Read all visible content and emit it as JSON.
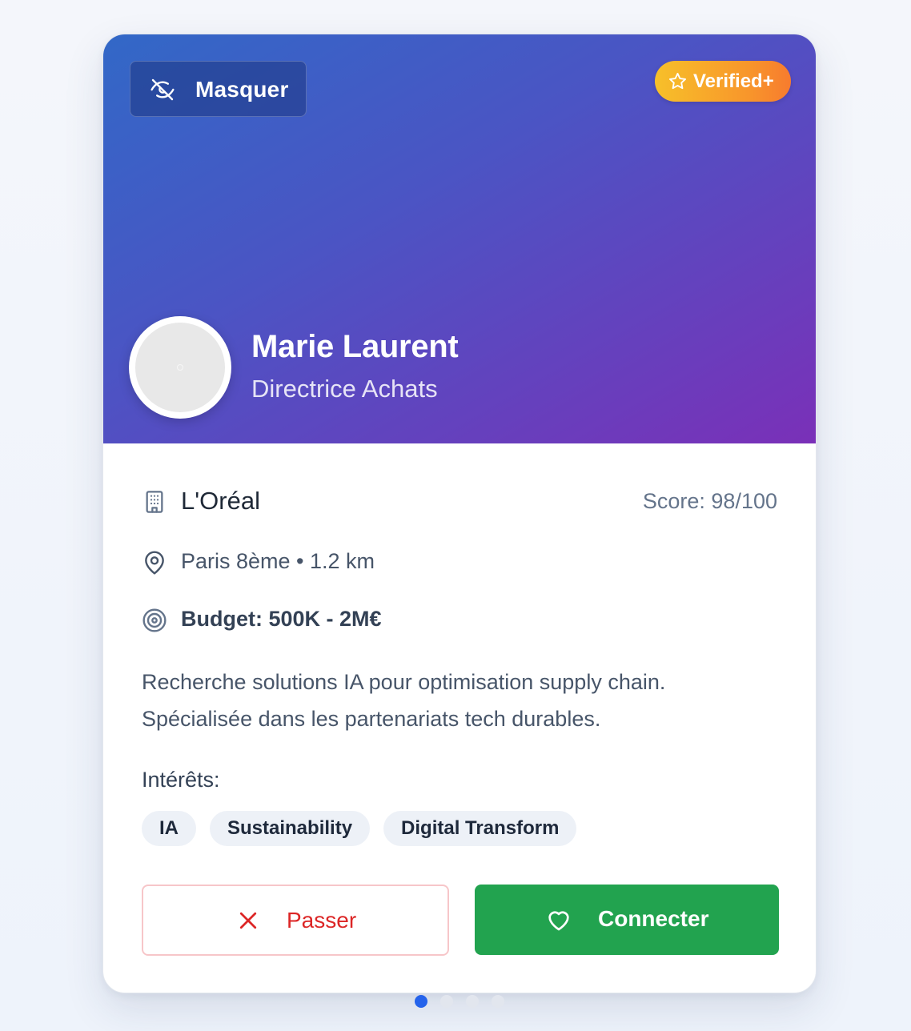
{
  "header": {
    "hide_label": "Masquer",
    "badge_label": "Verified+",
    "gradient_from": "#3268c7",
    "gradient_to": "#7a30b8"
  },
  "profile": {
    "name": "Marie Laurent",
    "role": "Directrice Achats",
    "company": "L'Oréal",
    "score": "Score: 98/100",
    "location": "Paris 8ème • 1.2 km",
    "budget": "Budget: 500K - 2M€",
    "description_line1": "Recherche solutions IA pour optimisation supply chain.",
    "description_line2": "Spécialisée dans les partenariats tech durables."
  },
  "interests": {
    "title": "Intérêts:",
    "tags": [
      "IA",
      "Sustainability",
      "Digital Transform"
    ]
  },
  "actions": {
    "pass_label": "Passer",
    "connect_label": "Connecter",
    "pass_color": "#dc2626",
    "connect_color": "#22a34f"
  },
  "pagination": {
    "total": 4,
    "active_index": 0
  },
  "icons": {
    "hide": "eye-off-icon",
    "badge": "star-icon",
    "company": "building-icon",
    "location": "map-pin-icon",
    "budget": "target-icon",
    "pass": "x-icon",
    "connect": "heart-icon"
  }
}
